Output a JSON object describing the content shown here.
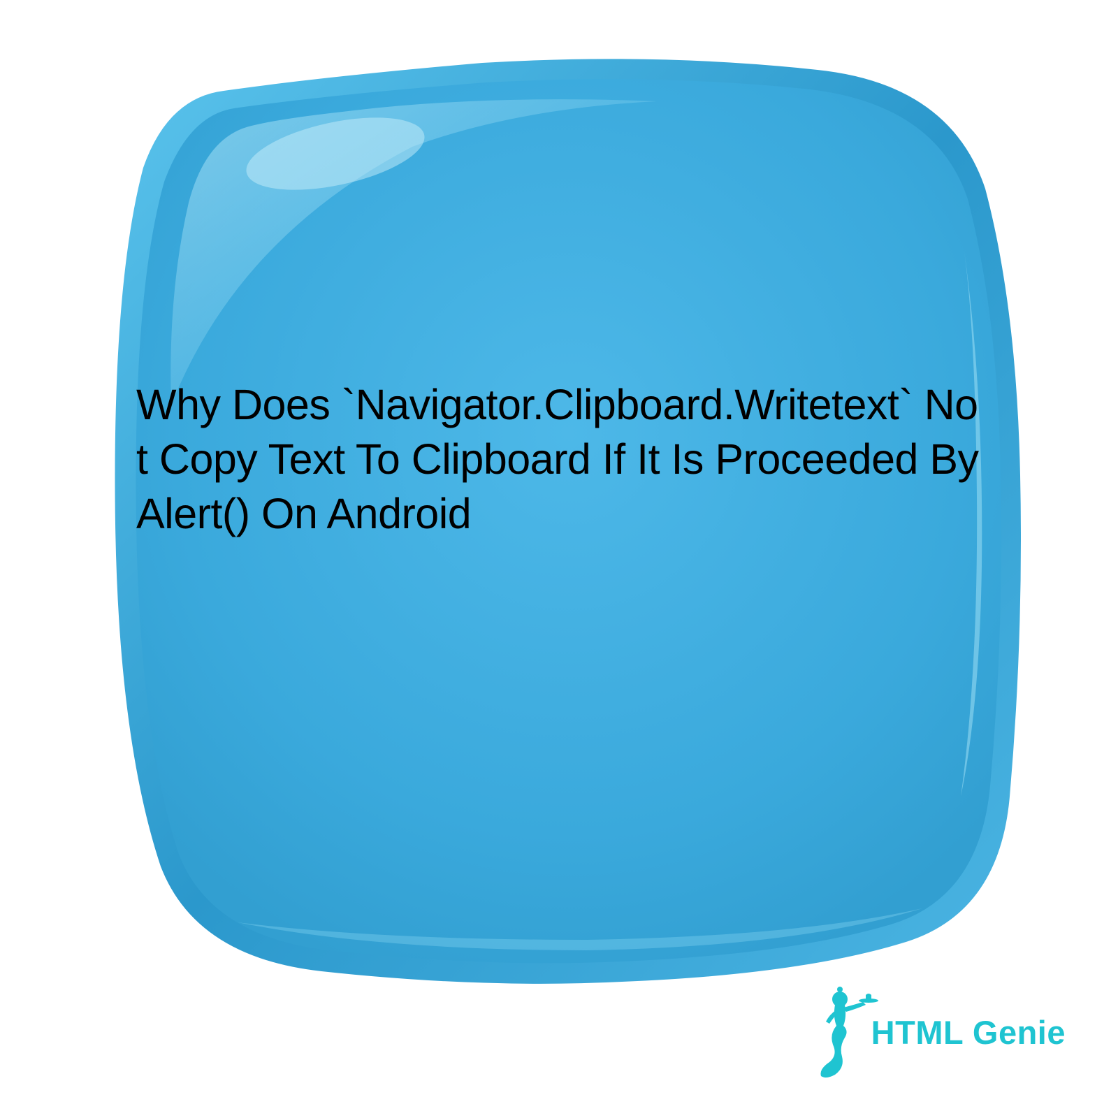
{
  "heading": "Why Does `Navigator.Clipboard.Writetext` Not Copy Text To Clipboard If It Is Proceeded By Alert() On Android",
  "logo": {
    "text": "HTML Genie"
  },
  "colors": {
    "blob_main": "#3aa9dc",
    "blob_highlight": "#6cc9ed",
    "blob_rim": "#2b98cc",
    "logo_color": "#1fc4d1"
  }
}
